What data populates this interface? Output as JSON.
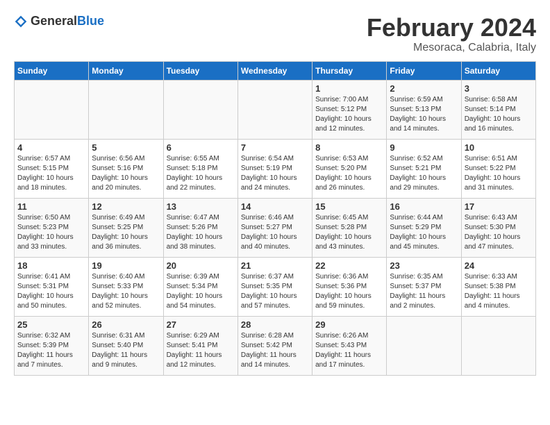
{
  "header": {
    "logo_general": "General",
    "logo_blue": "Blue",
    "title": "February 2024",
    "subtitle": "Mesoraca, Calabria, Italy"
  },
  "columns": [
    "Sunday",
    "Monday",
    "Tuesday",
    "Wednesday",
    "Thursday",
    "Friday",
    "Saturday"
  ],
  "weeks": [
    {
      "days": [
        {
          "num": "",
          "info": ""
        },
        {
          "num": "",
          "info": ""
        },
        {
          "num": "",
          "info": ""
        },
        {
          "num": "",
          "info": ""
        },
        {
          "num": "1",
          "info": "Sunrise: 7:00 AM\nSunset: 5:12 PM\nDaylight: 10 hours\nand 12 minutes."
        },
        {
          "num": "2",
          "info": "Sunrise: 6:59 AM\nSunset: 5:13 PM\nDaylight: 10 hours\nand 14 minutes."
        },
        {
          "num": "3",
          "info": "Sunrise: 6:58 AM\nSunset: 5:14 PM\nDaylight: 10 hours\nand 16 minutes."
        }
      ]
    },
    {
      "days": [
        {
          "num": "4",
          "info": "Sunrise: 6:57 AM\nSunset: 5:15 PM\nDaylight: 10 hours\nand 18 minutes."
        },
        {
          "num": "5",
          "info": "Sunrise: 6:56 AM\nSunset: 5:16 PM\nDaylight: 10 hours\nand 20 minutes."
        },
        {
          "num": "6",
          "info": "Sunrise: 6:55 AM\nSunset: 5:18 PM\nDaylight: 10 hours\nand 22 minutes."
        },
        {
          "num": "7",
          "info": "Sunrise: 6:54 AM\nSunset: 5:19 PM\nDaylight: 10 hours\nand 24 minutes."
        },
        {
          "num": "8",
          "info": "Sunrise: 6:53 AM\nSunset: 5:20 PM\nDaylight: 10 hours\nand 26 minutes."
        },
        {
          "num": "9",
          "info": "Sunrise: 6:52 AM\nSunset: 5:21 PM\nDaylight: 10 hours\nand 29 minutes."
        },
        {
          "num": "10",
          "info": "Sunrise: 6:51 AM\nSunset: 5:22 PM\nDaylight: 10 hours\nand 31 minutes."
        }
      ]
    },
    {
      "days": [
        {
          "num": "11",
          "info": "Sunrise: 6:50 AM\nSunset: 5:23 PM\nDaylight: 10 hours\nand 33 minutes."
        },
        {
          "num": "12",
          "info": "Sunrise: 6:49 AM\nSunset: 5:25 PM\nDaylight: 10 hours\nand 36 minutes."
        },
        {
          "num": "13",
          "info": "Sunrise: 6:47 AM\nSunset: 5:26 PM\nDaylight: 10 hours\nand 38 minutes."
        },
        {
          "num": "14",
          "info": "Sunrise: 6:46 AM\nSunset: 5:27 PM\nDaylight: 10 hours\nand 40 minutes."
        },
        {
          "num": "15",
          "info": "Sunrise: 6:45 AM\nSunset: 5:28 PM\nDaylight: 10 hours\nand 43 minutes."
        },
        {
          "num": "16",
          "info": "Sunrise: 6:44 AM\nSunset: 5:29 PM\nDaylight: 10 hours\nand 45 minutes."
        },
        {
          "num": "17",
          "info": "Sunrise: 6:43 AM\nSunset: 5:30 PM\nDaylight: 10 hours\nand 47 minutes."
        }
      ]
    },
    {
      "days": [
        {
          "num": "18",
          "info": "Sunrise: 6:41 AM\nSunset: 5:31 PM\nDaylight: 10 hours\nand 50 minutes."
        },
        {
          "num": "19",
          "info": "Sunrise: 6:40 AM\nSunset: 5:33 PM\nDaylight: 10 hours\nand 52 minutes."
        },
        {
          "num": "20",
          "info": "Sunrise: 6:39 AM\nSunset: 5:34 PM\nDaylight: 10 hours\nand 54 minutes."
        },
        {
          "num": "21",
          "info": "Sunrise: 6:37 AM\nSunset: 5:35 PM\nDaylight: 10 hours\nand 57 minutes."
        },
        {
          "num": "22",
          "info": "Sunrise: 6:36 AM\nSunset: 5:36 PM\nDaylight: 10 hours\nand 59 minutes."
        },
        {
          "num": "23",
          "info": "Sunrise: 6:35 AM\nSunset: 5:37 PM\nDaylight: 11 hours\nand 2 minutes."
        },
        {
          "num": "24",
          "info": "Sunrise: 6:33 AM\nSunset: 5:38 PM\nDaylight: 11 hours\nand 4 minutes."
        }
      ]
    },
    {
      "days": [
        {
          "num": "25",
          "info": "Sunrise: 6:32 AM\nSunset: 5:39 PM\nDaylight: 11 hours\nand 7 minutes."
        },
        {
          "num": "26",
          "info": "Sunrise: 6:31 AM\nSunset: 5:40 PM\nDaylight: 11 hours\nand 9 minutes."
        },
        {
          "num": "27",
          "info": "Sunrise: 6:29 AM\nSunset: 5:41 PM\nDaylight: 11 hours\nand 12 minutes."
        },
        {
          "num": "28",
          "info": "Sunrise: 6:28 AM\nSunset: 5:42 PM\nDaylight: 11 hours\nand 14 minutes."
        },
        {
          "num": "29",
          "info": "Sunrise: 6:26 AM\nSunset: 5:43 PM\nDaylight: 11 hours\nand 17 minutes."
        },
        {
          "num": "",
          "info": ""
        },
        {
          "num": "",
          "info": ""
        }
      ]
    }
  ]
}
